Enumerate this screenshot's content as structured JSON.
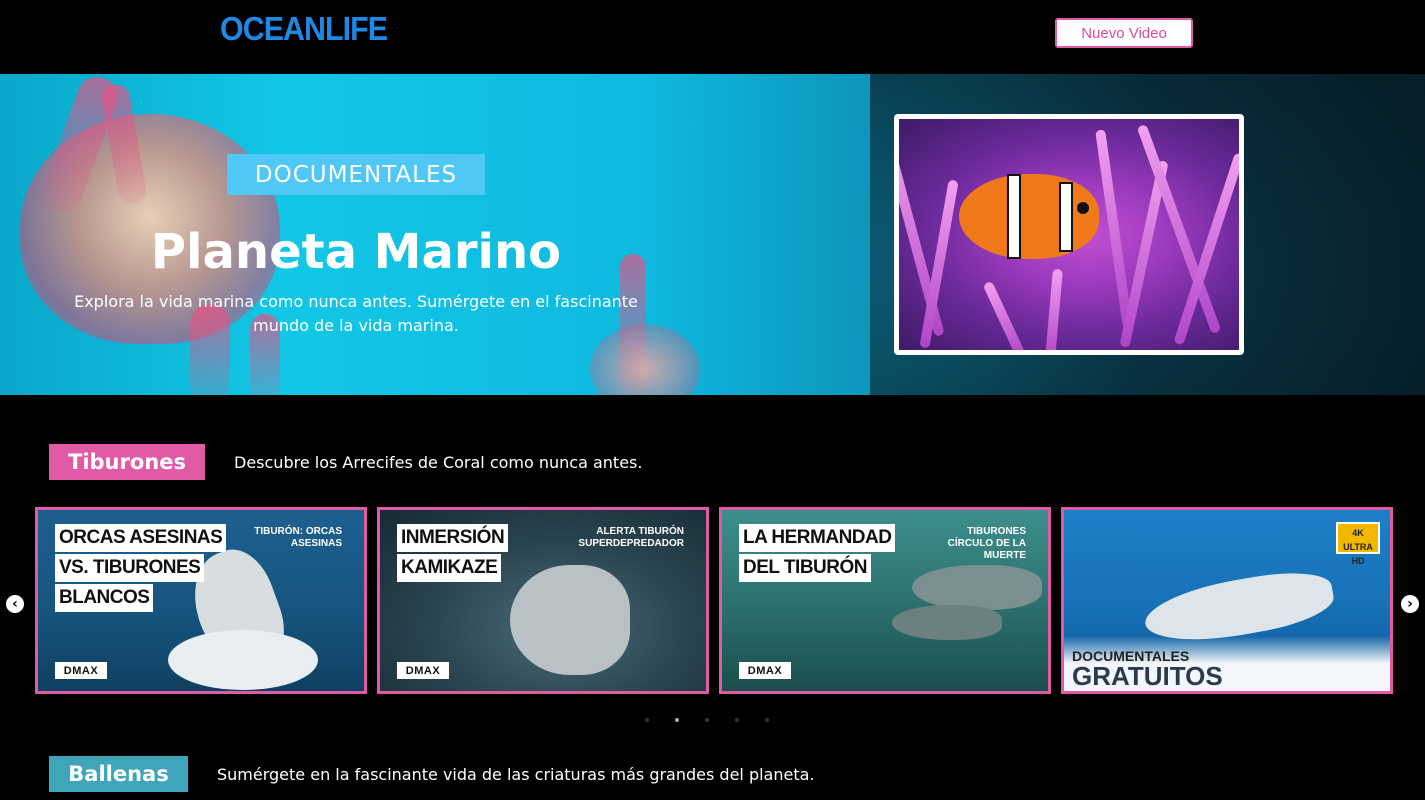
{
  "header": {
    "logo": "OCEANLIFE",
    "new_video_label": "Nuevo Video"
  },
  "hero": {
    "badge": "DOCUMENTALES",
    "title": "Planeta Marino",
    "subtitle": "Explora la vida marina como nunca antes. Sumérgete en el fascinante mundo de la vida marina."
  },
  "sections": [
    {
      "tag": "Tiburones",
      "description": "Descubre los Arrecifes de Coral como nunca antes.",
      "cards": [
        {
          "lines": [
            "ORCAS ASESINAS",
            "VS. TIBURONES",
            "BLANCOS"
          ],
          "corner": "TIBURÓN: ORCAS ASESINAS",
          "brand": "DMAX"
        },
        {
          "lines": [
            "INMERSIÓN",
            "KAMIKAZE"
          ],
          "corner": "ALERTA TIBURÓN SUPERDEPREDADOR",
          "brand": "DMAX"
        },
        {
          "lines": [
            "LA HERMANDAD",
            "DEL TIBURÓN"
          ],
          "corner": "TIBURONES CÍRCULO DE LA MUERTE",
          "brand": "DMAX"
        },
        {
          "lines": [
            "DOCUMENTALES",
            "GRATUITOS"
          ],
          "corner": "4K ULTRA HD",
          "brand": ""
        }
      ]
    },
    {
      "tag": "Ballenas",
      "description": "Sumérgete en la fascinante vida de las criaturas más grandes del planeta."
    }
  ],
  "carousel": {
    "prev_icon": "chevron-left-icon",
    "next_icon": "chevron-right-icon",
    "dots": 5,
    "active_dot": 2
  },
  "colors": {
    "accent_pink": "#e05aa6",
    "accent_teal": "#3ea6b8",
    "badge_blue": "#4fc8f5",
    "logo_blue": "#1e88e5"
  }
}
